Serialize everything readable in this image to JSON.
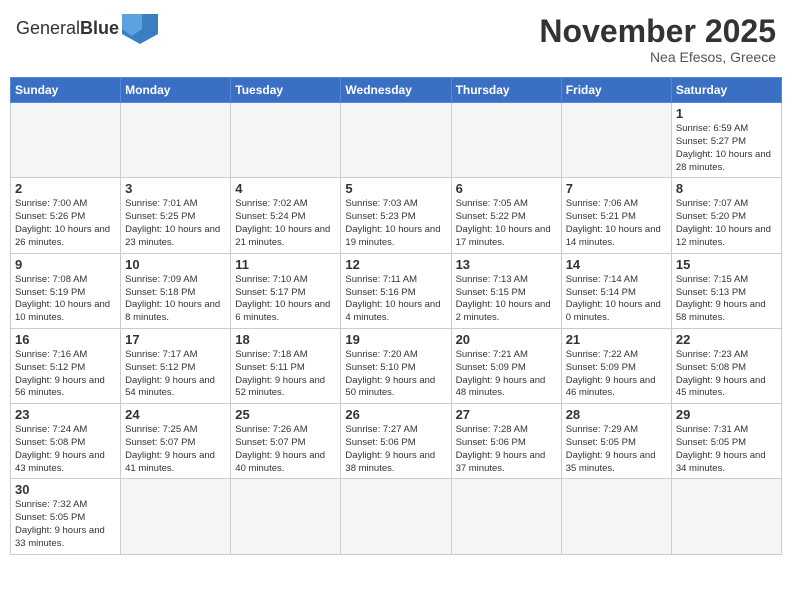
{
  "header": {
    "logo_text_normal": "General",
    "logo_text_bold": "Blue",
    "month_title": "November 2025",
    "location": "Nea Efesos, Greece"
  },
  "days_of_week": [
    "Sunday",
    "Monday",
    "Tuesday",
    "Wednesday",
    "Thursday",
    "Friday",
    "Saturday"
  ],
  "weeks": [
    [
      {
        "day": "",
        "info": ""
      },
      {
        "day": "",
        "info": ""
      },
      {
        "day": "",
        "info": ""
      },
      {
        "day": "",
        "info": ""
      },
      {
        "day": "",
        "info": ""
      },
      {
        "day": "",
        "info": ""
      },
      {
        "day": "1",
        "info": "Sunrise: 6:59 AM\nSunset: 5:27 PM\nDaylight: 10 hours and 28 minutes."
      }
    ],
    [
      {
        "day": "2",
        "info": "Sunrise: 7:00 AM\nSunset: 5:26 PM\nDaylight: 10 hours and 26 minutes."
      },
      {
        "day": "3",
        "info": "Sunrise: 7:01 AM\nSunset: 5:25 PM\nDaylight: 10 hours and 23 minutes."
      },
      {
        "day": "4",
        "info": "Sunrise: 7:02 AM\nSunset: 5:24 PM\nDaylight: 10 hours and 21 minutes."
      },
      {
        "day": "5",
        "info": "Sunrise: 7:03 AM\nSunset: 5:23 PM\nDaylight: 10 hours and 19 minutes."
      },
      {
        "day": "6",
        "info": "Sunrise: 7:05 AM\nSunset: 5:22 PM\nDaylight: 10 hours and 17 minutes."
      },
      {
        "day": "7",
        "info": "Sunrise: 7:06 AM\nSunset: 5:21 PM\nDaylight: 10 hours and 14 minutes."
      },
      {
        "day": "8",
        "info": "Sunrise: 7:07 AM\nSunset: 5:20 PM\nDaylight: 10 hours and 12 minutes."
      }
    ],
    [
      {
        "day": "9",
        "info": "Sunrise: 7:08 AM\nSunset: 5:19 PM\nDaylight: 10 hours and 10 minutes."
      },
      {
        "day": "10",
        "info": "Sunrise: 7:09 AM\nSunset: 5:18 PM\nDaylight: 10 hours and 8 minutes."
      },
      {
        "day": "11",
        "info": "Sunrise: 7:10 AM\nSunset: 5:17 PM\nDaylight: 10 hours and 6 minutes."
      },
      {
        "day": "12",
        "info": "Sunrise: 7:11 AM\nSunset: 5:16 PM\nDaylight: 10 hours and 4 minutes."
      },
      {
        "day": "13",
        "info": "Sunrise: 7:13 AM\nSunset: 5:15 PM\nDaylight: 10 hours and 2 minutes."
      },
      {
        "day": "14",
        "info": "Sunrise: 7:14 AM\nSunset: 5:14 PM\nDaylight: 10 hours and 0 minutes."
      },
      {
        "day": "15",
        "info": "Sunrise: 7:15 AM\nSunset: 5:13 PM\nDaylight: 9 hours and 58 minutes."
      }
    ],
    [
      {
        "day": "16",
        "info": "Sunrise: 7:16 AM\nSunset: 5:12 PM\nDaylight: 9 hours and 56 minutes."
      },
      {
        "day": "17",
        "info": "Sunrise: 7:17 AM\nSunset: 5:12 PM\nDaylight: 9 hours and 54 minutes."
      },
      {
        "day": "18",
        "info": "Sunrise: 7:18 AM\nSunset: 5:11 PM\nDaylight: 9 hours and 52 minutes."
      },
      {
        "day": "19",
        "info": "Sunrise: 7:20 AM\nSunset: 5:10 PM\nDaylight: 9 hours and 50 minutes."
      },
      {
        "day": "20",
        "info": "Sunrise: 7:21 AM\nSunset: 5:09 PM\nDaylight: 9 hours and 48 minutes."
      },
      {
        "day": "21",
        "info": "Sunrise: 7:22 AM\nSunset: 5:09 PM\nDaylight: 9 hours and 46 minutes."
      },
      {
        "day": "22",
        "info": "Sunrise: 7:23 AM\nSunset: 5:08 PM\nDaylight: 9 hours and 45 minutes."
      }
    ],
    [
      {
        "day": "23",
        "info": "Sunrise: 7:24 AM\nSunset: 5:08 PM\nDaylight: 9 hours and 43 minutes."
      },
      {
        "day": "24",
        "info": "Sunrise: 7:25 AM\nSunset: 5:07 PM\nDaylight: 9 hours and 41 minutes."
      },
      {
        "day": "25",
        "info": "Sunrise: 7:26 AM\nSunset: 5:07 PM\nDaylight: 9 hours and 40 minutes."
      },
      {
        "day": "26",
        "info": "Sunrise: 7:27 AM\nSunset: 5:06 PM\nDaylight: 9 hours and 38 minutes."
      },
      {
        "day": "27",
        "info": "Sunrise: 7:28 AM\nSunset: 5:06 PM\nDaylight: 9 hours and 37 minutes."
      },
      {
        "day": "28",
        "info": "Sunrise: 7:29 AM\nSunset: 5:05 PM\nDaylight: 9 hours and 35 minutes."
      },
      {
        "day": "29",
        "info": "Sunrise: 7:31 AM\nSunset: 5:05 PM\nDaylight: 9 hours and 34 minutes."
      }
    ],
    [
      {
        "day": "30",
        "info": "Sunrise: 7:32 AM\nSunset: 5:05 PM\nDaylight: 9 hours and 33 minutes."
      },
      {
        "day": "",
        "info": ""
      },
      {
        "day": "",
        "info": ""
      },
      {
        "day": "",
        "info": ""
      },
      {
        "day": "",
        "info": ""
      },
      {
        "day": "",
        "info": ""
      },
      {
        "day": "",
        "info": ""
      }
    ]
  ]
}
